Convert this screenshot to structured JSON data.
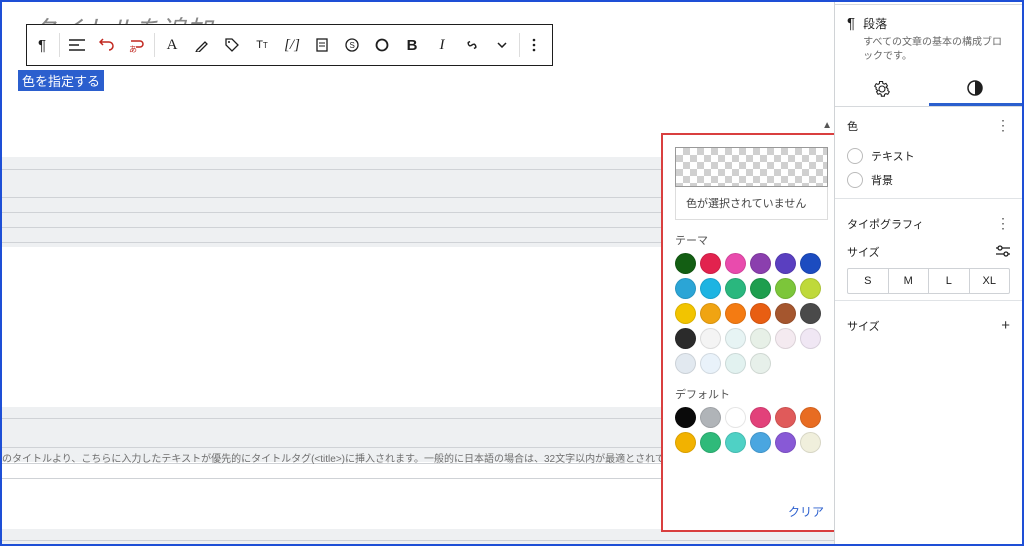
{
  "title_placeholder": "タイトルを追加",
  "selected_text": "色を指定する",
  "help_text": "のタイトルより、こちらに入力したテキストが優先的にタイトルタグ(<title>)に挿入されます。一般的に日本語の場合は、32文字以内が最適とされています。（※ページやインデ",
  "color_popover": {
    "no_color_msg": "色が選択されていません",
    "theme_label": "テーマ",
    "default_label": "デフォルト",
    "clear_label": "クリア",
    "theme_colors": [
      "#135e13",
      "#e2224e",
      "#e94bad",
      "#8b3fae",
      "#5a3fc0",
      "#1c4cc0",
      "#2ba5d6",
      "#1db4e2",
      "#2ab77e",
      "#1e9e4e",
      "#7cc63a",
      "#bfd93a",
      "#f2c400",
      "#f0a412",
      "#f47b12",
      "#e85e12",
      "#a5562e",
      "#4a4a4a",
      "#2b2b2b",
      "#f4f4f4",
      "#e7f4f4",
      "#e7f0e7",
      "#f4eaf0",
      "#f0e7f4",
      "#e2e9f0",
      "#e9f2fa",
      "#e2f2f0",
      "#e7f0ea"
    ],
    "default_colors": [
      "#0a0a0a",
      "#b0b4b8",
      "#ffffff",
      "#e2417a",
      "#e05a5a",
      "#e86c22",
      "#f2b200",
      "#2fba7a",
      "#4fd1c5",
      "#4aa6e0",
      "#8859d6",
      "#f0efdc"
    ]
  },
  "sidebar": {
    "block_title": "段落",
    "block_desc": "すべての文章の基本の構成ブロックです。",
    "color_label": "色",
    "text_label": "テキスト",
    "bg_label": "背景",
    "typo_label": "タイポグラフィ",
    "size_label": "サイズ",
    "sizes": [
      "S",
      "M",
      "L",
      "XL"
    ],
    "dim_label": "サイズ"
  }
}
